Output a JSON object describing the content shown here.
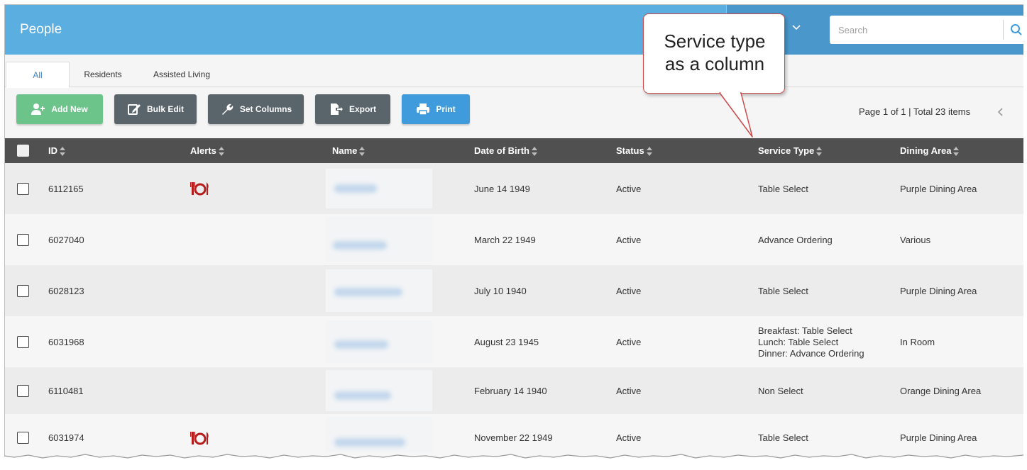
{
  "header": {
    "title": "People",
    "search_placeholder": "Search"
  },
  "tabs": [
    {
      "label": "All",
      "active": true
    },
    {
      "label": "Residents",
      "active": false
    },
    {
      "label": "Assisted Living",
      "active": false
    }
  ],
  "toolbar": {
    "add_new": "Add New",
    "bulk_edit": "Bulk Edit",
    "set_columns": "Set Columns",
    "export": "Export",
    "print": "Print"
  },
  "pager": {
    "text": "Page 1 of 1 | Total 23 items"
  },
  "table": {
    "columns": [
      "ID",
      "Alerts",
      "Name",
      "Date of Birth",
      "Status",
      "Service Type",
      "Dining Area"
    ],
    "rows": [
      {
        "id": "6112165",
        "alert": "dining-alert-icon",
        "dob": "June 14 1949",
        "status": "Active",
        "service_type": "Table Select",
        "dining_area": "Purple Dining Area"
      },
      {
        "id": "6027040",
        "alert": "",
        "dob": "March 22 1949",
        "status": "Active",
        "service_type": "Advance Ordering",
        "dining_area": "Various"
      },
      {
        "id": "6028123",
        "alert": "",
        "dob": "July 10 1940",
        "status": "Active",
        "service_type": "Table Select",
        "dining_area": "Purple Dining Area"
      },
      {
        "id": "6031968",
        "alert": "",
        "dob": "August 23 1945",
        "status": "Active",
        "service_type_lines": [
          "Breakfast: Table Select",
          "Lunch: Table Select",
          "Dinner: Advance Ordering"
        ],
        "dining_area": "In Room"
      },
      {
        "id": "6110481",
        "alert": "",
        "dob": "February 14 1940",
        "status": "Active",
        "service_type": "Non Select",
        "dining_area": "Orange Dining Area"
      },
      {
        "id": "6031974",
        "alert": "dining-alert-icon",
        "dob": "November 22 1949",
        "status": "Active",
        "service_type": "Table Select",
        "dining_area": "Purple Dining Area"
      }
    ]
  },
  "callout": {
    "line1": "Service type",
    "line2": "as a column"
  },
  "colors": {
    "header_bg": "#5aaee0",
    "table_header_bg": "#505050",
    "add_button": "#6dc48b",
    "dark_button": "#59646b",
    "print_button": "#3f9bdb",
    "alert_icon": "#b71c1c",
    "callout_border": "#d04848"
  }
}
